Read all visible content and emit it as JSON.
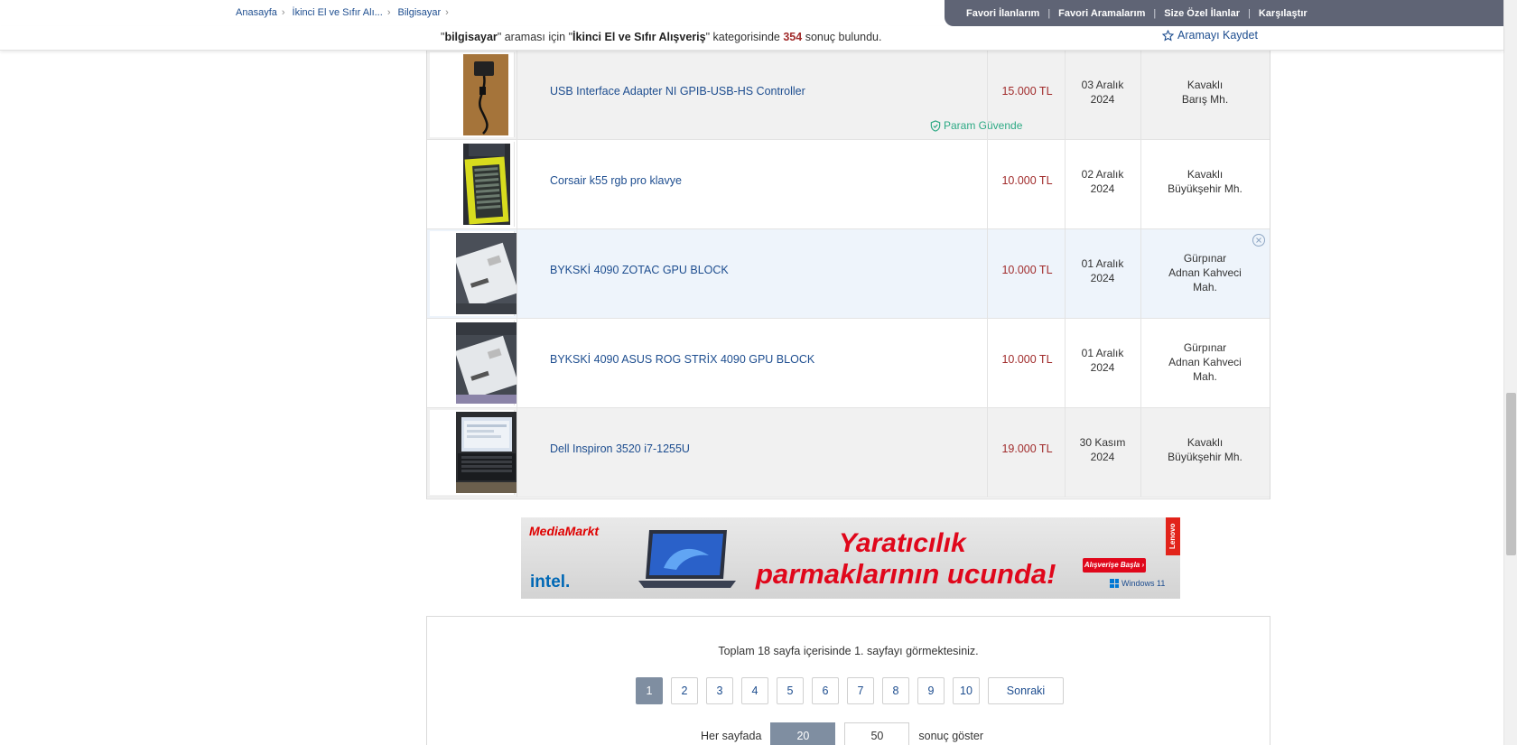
{
  "breadcrumb": [
    "Anasayfa",
    "İkinci El ve Sıfır Alı...",
    "Bilgisayar"
  ],
  "toplinks": [
    "Favori İlanlarım",
    "Favori Aramalarım",
    "Size Özel İlanlar",
    "Karşılaştır"
  ],
  "search": {
    "query": "bilgisayar",
    "middle": "araması için",
    "category": "İkinci El ve Sıfır Alışveriş",
    "category_suffix": "kategorisinde",
    "count": "354",
    "count_suffix": "sonuç bulundu.",
    "save_label": "Aramayı Kaydet"
  },
  "listings": [
    {
      "title": "USB Interface Adapter NI GPIB-USB-HS Controller",
      "price": "15.000 TL",
      "date_day": "03 Aralık",
      "date_year": "2024",
      "location": [
        "Kavaklı",
        "Barış Mh."
      ],
      "badge": "Param Güvende"
    },
    {
      "title": "Corsair k55 rgb pro klavye",
      "price": "10.000 TL",
      "date_day": "02 Aralık",
      "date_year": "2024",
      "location": [
        "Kavaklı",
        "Büyükşehir Mh."
      ]
    },
    {
      "title": "BYKSKİ 4090 ZOTAC GPU BLOCK",
      "price": "10.000 TL",
      "date_day": "01 Aralık",
      "date_year": "2024",
      "location": [
        "Gürpınar",
        "Adnan Kahveci",
        "Mah."
      ]
    },
    {
      "title": "BYKSKİ 4090 ASUS ROG STRİX 4090 GPU BLOCK",
      "price": "10.000 TL",
      "date_day": "01 Aralık",
      "date_year": "2024",
      "location": [
        "Gürpınar",
        "Adnan Kahveci",
        "Mah."
      ]
    },
    {
      "title": "Dell Inspiron 3520 i7-1255U",
      "price": "19.000 TL",
      "date_day": "30 Kasım",
      "date_year": "2024",
      "location": [
        "Kavaklı",
        "Büyükşehir Mh."
      ]
    }
  ],
  "banner": {
    "store": "MediaMarkt",
    "chip": "intel.",
    "headline_1": "Yaratıcılık",
    "headline_2": "parmaklarının ucunda!",
    "cta": "Alışverişe Başla ›",
    "os": "Windows 11",
    "brand": "Lenovo"
  },
  "pagination": {
    "info": "Toplam 18 sayfa içerisinde 1. sayfayı görmektesiniz.",
    "pages": [
      "1",
      "2",
      "3",
      "4",
      "5",
      "6",
      "7",
      "8",
      "9",
      "10"
    ],
    "current": "1",
    "next_label": "Sonraki",
    "per_page_label": "Her sayfada",
    "per_page_options": [
      "20",
      "50"
    ],
    "per_page_selected": "20",
    "per_page_suffix": "sonuç göster"
  },
  "colors": {
    "link": "#1d4d8f",
    "price": "#a12c2c",
    "topbar": "#5f6475",
    "secure": "#2eaa85",
    "active_page": "#7f8ea1"
  }
}
